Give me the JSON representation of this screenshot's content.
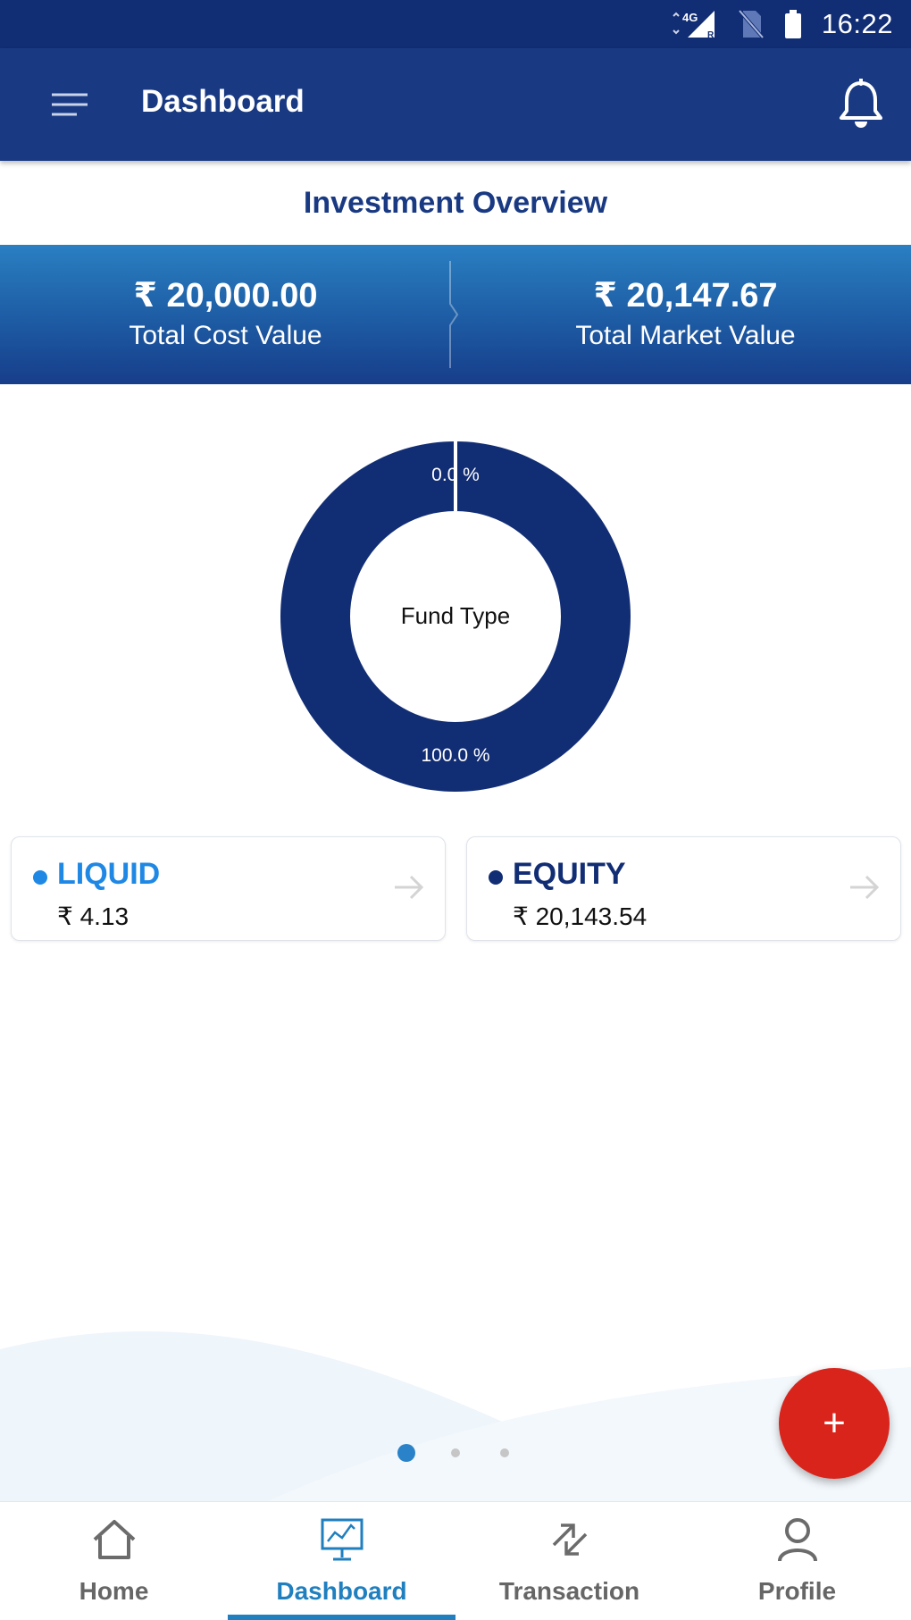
{
  "status_bar": {
    "network_label": "4G",
    "roaming_label": "R",
    "time": "16:22"
  },
  "app_bar": {
    "title": "Dashboard",
    "menu_icon": "hamburger-icon",
    "notification_icon": "bell-icon"
  },
  "overview": {
    "title": "Investment Overview",
    "cost_amount": "₹ 20,000.00",
    "cost_label": "Total Cost Value",
    "market_amount": "₹ 20,147.67",
    "market_label": "Total Market Value"
  },
  "chart_data": {
    "type": "pie",
    "title": "",
    "center_label": "Fund Type",
    "slices": [
      {
        "name": "LIQUID",
        "value": 4.13,
        "label": "0.0 %",
        "color": "#1f88e5"
      },
      {
        "name": "EQUITY",
        "value": 20143.54,
        "label": "100.0 %",
        "color": "#112d74"
      }
    ]
  },
  "funds": [
    {
      "name": "LIQUID",
      "value": "₹ 4.13",
      "color": "#1f88e5"
    },
    {
      "name": "EQUITY",
      "value": "₹ 20,143.54",
      "color": "#112d74"
    }
  ],
  "pager": {
    "pages": 3,
    "active_index": 0
  },
  "fab": {
    "label": "+"
  },
  "bottom_nav": {
    "items": [
      {
        "label": "Home",
        "icon": "home-icon"
      },
      {
        "label": "Dashboard",
        "icon": "dashboard-monitor-icon"
      },
      {
        "label": "Transaction",
        "icon": "swap-arrows-icon"
      },
      {
        "label": "Profile",
        "icon": "user-icon"
      }
    ],
    "active_index": 1
  },
  "colors": {
    "primary": "#193a82",
    "status_bar": "#112d74",
    "accent_blue": "#1f7fbf",
    "fab_red": "#d9241c"
  }
}
